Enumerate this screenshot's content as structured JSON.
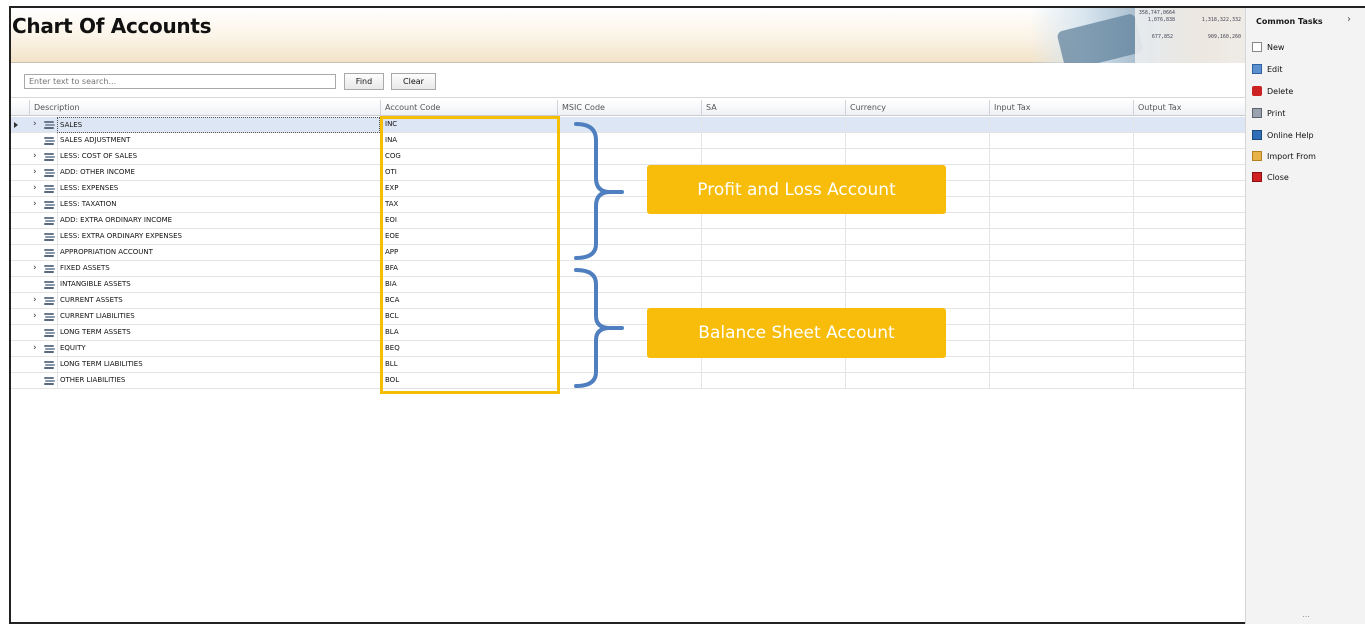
{
  "header": {
    "title": "Chart Of Accounts",
    "art_numbers": [
      "358,747,0664",
      "1,076,838",
      "1,318,322,332",
      "677,852",
      "909,160,260"
    ]
  },
  "search": {
    "placeholder": "Enter text to search...",
    "find_label": "Find",
    "clear_label": "Clear"
  },
  "grid": {
    "columns": [
      "Description",
      "Account Code",
      "MSIC Code",
      "SA",
      "Currency",
      "Input Tax",
      "Output Tax"
    ],
    "rows": [
      {
        "description": "SALES",
        "code": "INC",
        "expandable": true,
        "selected": true
      },
      {
        "description": "SALES ADJUSTMENT",
        "code": "INA",
        "expandable": false
      },
      {
        "description": "LESS: COST OF SALES",
        "code": "COG",
        "expandable": true
      },
      {
        "description": "ADD: OTHER INCOME",
        "code": "OTI",
        "expandable": true
      },
      {
        "description": "LESS: EXPENSES",
        "code": "EXP",
        "expandable": true
      },
      {
        "description": "LESS: TAXATION",
        "code": "TAX",
        "expandable": true
      },
      {
        "description": "ADD: EXTRA ORDINARY INCOME",
        "code": "EOI",
        "expandable": false
      },
      {
        "description": "LESS: EXTRA ORDINARY EXPENSES",
        "code": "EOE",
        "expandable": false
      },
      {
        "description": "APPROPRIATION ACCOUNT",
        "code": "APP",
        "expandable": false
      },
      {
        "description": "FIXED ASSETS",
        "code": "BFA",
        "expandable": true
      },
      {
        "description": "INTANGIBLE ASSETS",
        "code": "BIA",
        "expandable": false
      },
      {
        "description": "CURRENT ASSETS",
        "code": "BCA",
        "expandable": true
      },
      {
        "description": "CURRENT LIABILITIES",
        "code": "BCL",
        "expandable": true
      },
      {
        "description": "LONG TERM ASSETS",
        "code": "BLA",
        "expandable": false
      },
      {
        "description": "EQUITY",
        "code": "BEQ",
        "expandable": true
      },
      {
        "description": "LONG TERM LIABILITIES",
        "code": "BLL",
        "expandable": false
      },
      {
        "description": "OTHER LIABILITIES",
        "code": "BOL",
        "expandable": false
      }
    ]
  },
  "annotations": {
    "profit_loss": "Profit and Loss Account",
    "balance_sheet": "Balance Sheet Account",
    "accent_color": "#f8bd0a",
    "brace_color": "#4f7fbf"
  },
  "side_panel": {
    "title": "Common Tasks",
    "tasks": [
      {
        "label": "New",
        "icon": "new-icon"
      },
      {
        "label": "Edit",
        "icon": "edit-icon"
      },
      {
        "label": "Delete",
        "icon": "delete-icon"
      },
      {
        "label": "Print",
        "icon": "print-icon"
      },
      {
        "label": "Online Help",
        "icon": "help-icon"
      },
      {
        "label": "Import From",
        "icon": "import-icon"
      },
      {
        "label": "Close",
        "icon": "close-icon"
      }
    ]
  }
}
